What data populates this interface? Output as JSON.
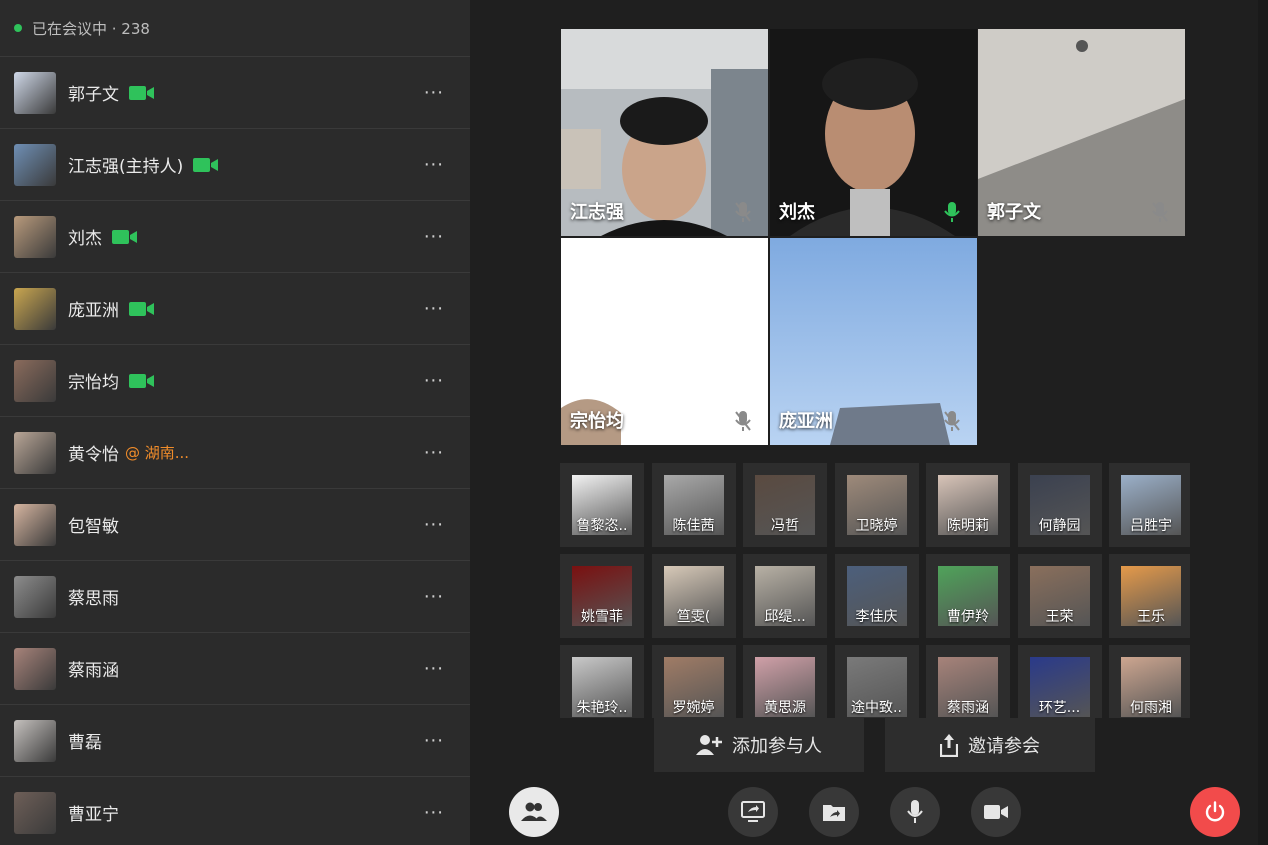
{
  "sidebar": {
    "status_text": "已在会议中 · 238",
    "participants": [
      {
        "name": "郭子文",
        "camera": true,
        "location": "",
        "avatar_color": "#cfd8e8"
      },
      {
        "name": "江志强(主持人)",
        "camera": true,
        "location": "",
        "avatar_color": "#6f8fb5"
      },
      {
        "name": "刘杰",
        "camera": true,
        "location": "",
        "avatar_color": "#b89a7c"
      },
      {
        "name": "庞亚洲",
        "camera": true,
        "location": "",
        "avatar_color": "#c9a650"
      },
      {
        "name": "宗怡均",
        "camera": true,
        "location": "",
        "avatar_color": "#8a6b5c"
      },
      {
        "name": "黄令怡",
        "camera": false,
        "location": "@ 湖南...",
        "avatar_color": "#b9a697"
      },
      {
        "name": "包智敏",
        "camera": false,
        "location": "",
        "avatar_color": "#d6b5a0"
      },
      {
        "name": "蔡思雨",
        "camera": false,
        "location": "",
        "avatar_color": "#8d8d8d"
      },
      {
        "name": "蔡雨涵",
        "camera": false,
        "location": "",
        "avatar_color": "#a7837a"
      },
      {
        "name": "曹磊",
        "camera": false,
        "location": "",
        "avatar_color": "#c5c1be"
      },
      {
        "name": "曹亚宁",
        "camera": false,
        "location": "",
        "avatar_color": "#6e5f58"
      }
    ],
    "more_label": "···"
  },
  "videos": [
    {
      "name": "江志强",
      "mic": "muted",
      "bg": "#9aa2a8"
    },
    {
      "name": "刘杰",
      "mic": "active",
      "bg": "#1b1b1b"
    },
    {
      "name": "郭子文",
      "mic": "muted",
      "bg": "#c7c4bf"
    },
    {
      "name": "宗怡均",
      "mic": "muted",
      "bg": "#ffffff"
    },
    {
      "name": "庞亚洲",
      "mic": "muted",
      "bg": "#8fb5e6"
    }
  ],
  "thumbnails": [
    {
      "name": "鲁黎恣..",
      "bg": "#f2f2f2"
    },
    {
      "name": "陈佳茜",
      "bg": "#a9a9a9"
    },
    {
      "name": "冯哲",
      "bg": "#5a4a40"
    },
    {
      "name": "卫晓婷",
      "bg": "#9e8a7a"
    },
    {
      "name": "陈明莉",
      "bg": "#d8c4b8"
    },
    {
      "name": "何静园",
      "bg": "#3b4150"
    },
    {
      "name": "吕胜宇",
      "bg": "#9bb0c9"
    },
    {
      "name": "姚雪菲",
      "bg": "#7a1010"
    },
    {
      "name": "笪雯(",
      "bg": "#d7c9b8"
    },
    {
      "name": "邱缇...",
      "bg": "#b8b1a5"
    },
    {
      "name": "李佳庆",
      "bg": "#4c5f7c"
    },
    {
      "name": "曹伊羚",
      "bg": "#4fa35a"
    },
    {
      "name": "王荣",
      "bg": "#8a6f5c"
    },
    {
      "name": "王乐",
      "bg": "#e59a4a"
    },
    {
      "name": "朱艳玲..",
      "bg": "#c9c9c9"
    },
    {
      "name": "罗婉婷",
      "bg": "#a07c66"
    },
    {
      "name": "黄思源",
      "bg": "#d0a0a8"
    },
    {
      "name": "途中致..",
      "bg": "#7a7a7a"
    },
    {
      "name": "蔡雨涵",
      "bg": "#a7837a"
    },
    {
      "name": "环艺...",
      "bg": "#2a3a8a"
    },
    {
      "name": "何雨湘",
      "bg": "#cda690"
    }
  ],
  "actions": {
    "add_participant": "添加参与人",
    "invite": "邀请参会"
  },
  "colors": {
    "accent_green": "#2fc25b",
    "end_call_red": "#f24b4b",
    "location_orange": "#f08c2a"
  }
}
